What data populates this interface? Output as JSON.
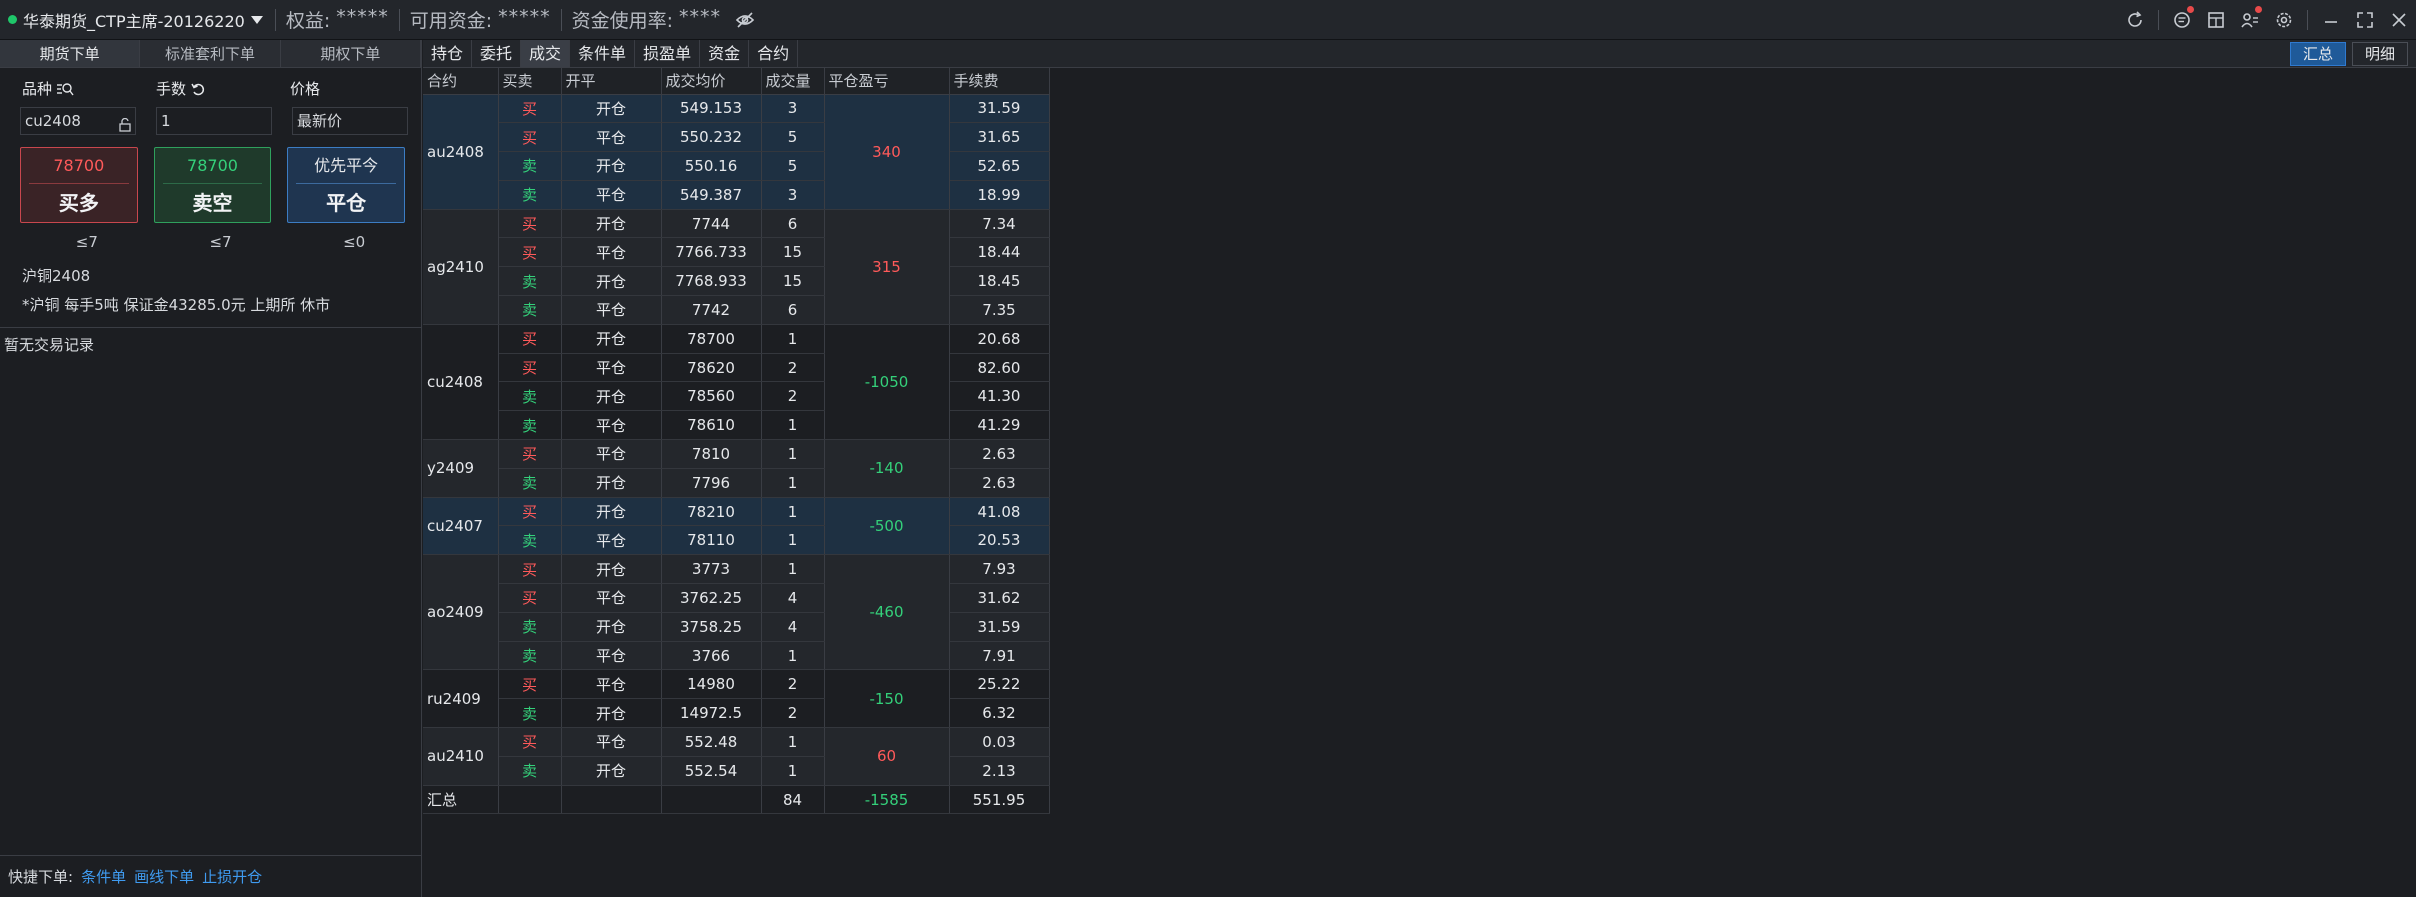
{
  "topbar": {
    "account": "华泰期货_CTP主席-20126220",
    "equity_label": "权益:",
    "equity_value": "*****",
    "available_label": "可用资金:",
    "available_value": "*****",
    "usage_label": "资金使用率:",
    "usage_value": "****"
  },
  "left": {
    "tabs": [
      "期货下单",
      "标准套利下单",
      "期权下单"
    ],
    "labels": {
      "variety": "品种",
      "lots": "手数",
      "price": "价格"
    },
    "inputs": {
      "variety": "cu2408",
      "lots": "1",
      "price": "最新价"
    },
    "buttons": {
      "buy_price": "78700",
      "buy_label": "买多",
      "sell_price": "78700",
      "sell_label": "卖空",
      "close_top": "优先平今",
      "close_label": "平仓"
    },
    "limits": [
      "≤7",
      "≤7",
      "≤0"
    ],
    "contract_name": "沪铜2408",
    "contract_desc": "*沪铜 每手5吨 保证金43285.0元 上期所 休市",
    "no_record": "暂无交易记录",
    "quick": {
      "label": "快捷下单:",
      "links": [
        "条件单",
        "画线下单",
        "止损开仓"
      ]
    }
  },
  "right": {
    "tabs": [
      "持仓",
      "委托",
      "成交",
      "条件单",
      "损盈单",
      "资金",
      "合约"
    ],
    "active_tab": "成交",
    "view_buttons": [
      "汇总",
      "明细"
    ],
    "columns": [
      "合约",
      "买卖",
      "开平",
      "成交均价",
      "成交量",
      "平仓盈亏",
      "手续费"
    ],
    "groups": [
      {
        "contract": "au2408",
        "pnl": "340",
        "style": "hl",
        "rows": [
          [
            "买",
            "开仓",
            "549.153",
            "3",
            "31.59"
          ],
          [
            "买",
            "平仓",
            "550.232",
            "5",
            "31.65"
          ],
          [
            "卖",
            "开仓",
            "550.16",
            "5",
            "52.65"
          ],
          [
            "卖",
            "平仓",
            "549.387",
            "3",
            "18.99"
          ]
        ]
      },
      {
        "contract": "ag2410",
        "pnl": "315",
        "style": "alt",
        "rows": [
          [
            "买",
            "开仓",
            "7744",
            "6",
            "7.34"
          ],
          [
            "买",
            "平仓",
            "7766.733",
            "15",
            "18.44"
          ],
          [
            "卖",
            "开仓",
            "7768.933",
            "15",
            "18.45"
          ],
          [
            "卖",
            "平仓",
            "7742",
            "6",
            "7.35"
          ]
        ]
      },
      {
        "contract": "cu2408",
        "pnl": "-1050",
        "style": "base",
        "rows": [
          [
            "买",
            "开仓",
            "78700",
            "1",
            "20.68"
          ],
          [
            "买",
            "平仓",
            "78620",
            "2",
            "82.60"
          ],
          [
            "卖",
            "开仓",
            "78560",
            "2",
            "41.30"
          ],
          [
            "卖",
            "平仓",
            "78610",
            "1",
            "41.29"
          ]
        ]
      },
      {
        "contract": "y2409",
        "pnl": "-140",
        "style": "alt",
        "rows": [
          [
            "买",
            "平仓",
            "7810",
            "1",
            "2.63"
          ],
          [
            "卖",
            "开仓",
            "7796",
            "1",
            "2.63"
          ]
        ]
      },
      {
        "contract": "cu2407",
        "pnl": "-500",
        "style": "hl",
        "rows": [
          [
            "买",
            "开仓",
            "78210",
            "1",
            "41.08"
          ],
          [
            "卖",
            "平仓",
            "78110",
            "1",
            "20.53"
          ]
        ]
      },
      {
        "contract": "ao2409",
        "pnl": "-460",
        "style": "alt",
        "rows": [
          [
            "买",
            "开仓",
            "3773",
            "1",
            "7.93"
          ],
          [
            "买",
            "平仓",
            "3762.25",
            "4",
            "31.62"
          ],
          [
            "卖",
            "开仓",
            "3758.25",
            "4",
            "31.59"
          ],
          [
            "卖",
            "平仓",
            "3766",
            "1",
            "7.91"
          ]
        ]
      },
      {
        "contract": "ru2409",
        "pnl": "-150",
        "style": "base",
        "rows": [
          [
            "买",
            "平仓",
            "14980",
            "2",
            "25.22"
          ],
          [
            "卖",
            "开仓",
            "14972.5",
            "2",
            "6.32"
          ]
        ]
      },
      {
        "contract": "au2410",
        "pnl": "60",
        "style": "alt",
        "rows": [
          [
            "买",
            "平仓",
            "552.48",
            "1",
            "0.03"
          ],
          [
            "卖",
            "开仓",
            "552.54",
            "1",
            "2.13"
          ]
        ]
      }
    ],
    "summary": {
      "label": "汇总",
      "volume": "84",
      "pnl": "-1585",
      "fee": "551.95"
    }
  }
}
